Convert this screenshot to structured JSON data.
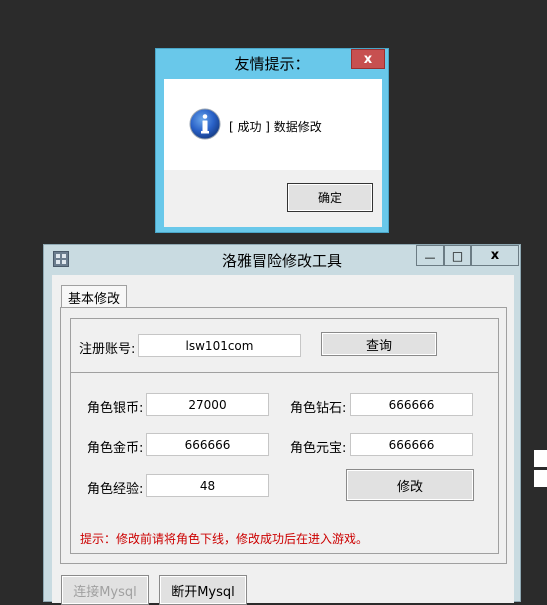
{
  "dialog": {
    "title": "友情提示：",
    "close_glyph": "x",
    "message": "[ 成功 ] 数据修改",
    "ok_label": "确定"
  },
  "window": {
    "title": "洛雅冒险修改工具",
    "min_glyph": "—",
    "max_glyph": "□",
    "close_glyph": "x",
    "tab_label": "基本修改",
    "account": {
      "label": "注册账号:",
      "value": "lsw101com",
      "query_label": "查询"
    },
    "fields": {
      "silver_label": "角色银币:",
      "silver_value": "27000",
      "diamond_label": "角色钻石:",
      "diamond_value": "666666",
      "gold_label": "角色金币:",
      "gold_value": "666666",
      "ingot_label": "角色元宝:",
      "ingot_value": "666666",
      "exp_label": "角色经验:",
      "exp_value": "48",
      "modify_label": "修改"
    },
    "hint": "提示：修改前请将角色下线，修改成功后在进入游戏。",
    "connect_label": "连接Mysql",
    "disconnect_label": "断开Mysql"
  },
  "icons": {
    "info": "info-icon",
    "app": "app-icon"
  },
  "colors": {
    "dialog_frame": "#69c8ea",
    "close_button": "#c75050",
    "window_frame": "#c9dbe1",
    "hint_text": "#cc0000",
    "desktop": "#2b2b2b"
  }
}
